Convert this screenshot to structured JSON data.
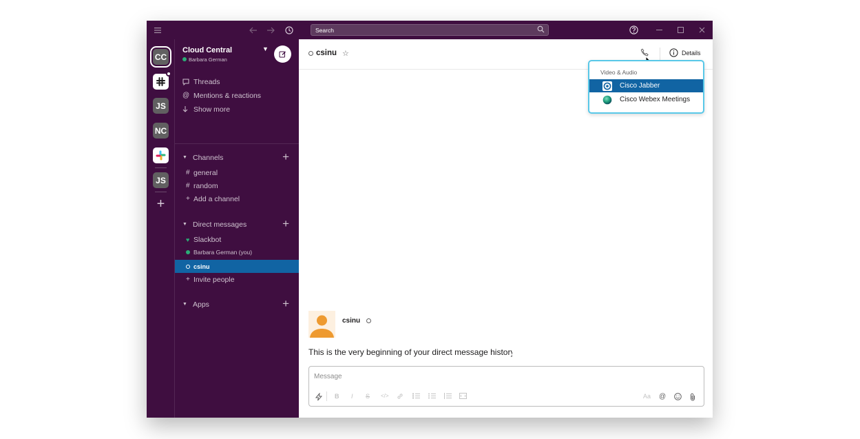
{
  "titlebar": {
    "search_label": "Search",
    "colors": {
      "bg": "#3f0e40"
    }
  },
  "workspaces": [
    {
      "label": "CC",
      "active": true
    },
    {
      "label": "slack-logo"
    },
    {
      "label": "JS"
    },
    {
      "label": "NC"
    },
    {
      "label": "slack-color-logo"
    },
    {
      "label": "JS"
    }
  ],
  "sidebar": {
    "team_name": "Cloud Central",
    "user_name": "Barbara German",
    "nav": [
      {
        "label": "Threads",
        "icon": "threads-icon"
      },
      {
        "label": "Mentions & reactions",
        "icon": "at-icon"
      },
      {
        "label": "Show more",
        "icon": "arrow-down-icon"
      }
    ],
    "channels_header": "Channels",
    "channels": [
      {
        "label": "general"
      },
      {
        "label": "random"
      }
    ],
    "add_channel": "Add a channel",
    "dm_header": "Direct messages",
    "dms": [
      {
        "label": "Slackbot"
      },
      {
        "label": "Barbara German (you)"
      },
      {
        "label": "csinu",
        "selected": true
      }
    ],
    "invite": "Invite people",
    "apps_header": "Apps"
  },
  "channel": {
    "name": "csinu",
    "details_label": "Details"
  },
  "call_menu": {
    "title": "Video & Audio",
    "items": [
      {
        "label": "Cisco Jabber",
        "highlighted": true
      },
      {
        "label": "Cisco Webex Meetings"
      }
    ]
  },
  "messages": {
    "user": "csinu",
    "intro": "This is the very beginning of your direct message history"
  },
  "composer": {
    "placeholder": "Message"
  },
  "accent": {
    "selected": "#1164a3",
    "popup_border": "#58c8e8",
    "online": "#2bac76"
  }
}
